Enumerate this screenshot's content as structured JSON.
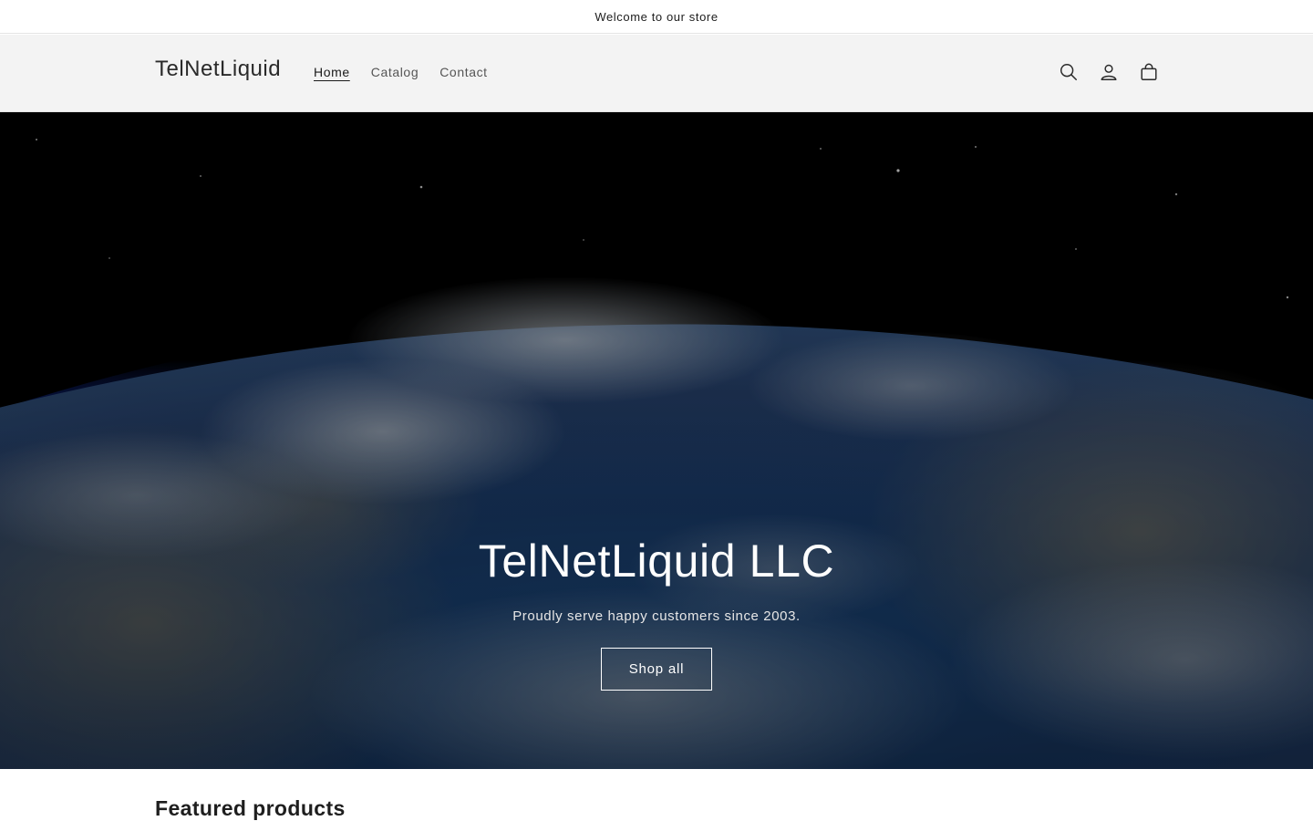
{
  "announcement": {
    "text": "Welcome to our store"
  },
  "header": {
    "logo": "TelNetLiquid",
    "nav": [
      {
        "label": "Home",
        "active": true
      },
      {
        "label": "Catalog",
        "active": false
      },
      {
        "label": "Contact",
        "active": false
      }
    ],
    "icons": [
      "search-icon",
      "account-icon",
      "cart-icon"
    ]
  },
  "hero": {
    "title": "TelNetLiquid LLC",
    "subtitle": "Proudly serve happy customers since 2003.",
    "button_label": "Shop all"
  },
  "featured": {
    "title": "Featured products"
  },
  "colors": {
    "header_bg": "#f3f3f3",
    "text": "#121212",
    "hero_text": "#ffffff"
  }
}
